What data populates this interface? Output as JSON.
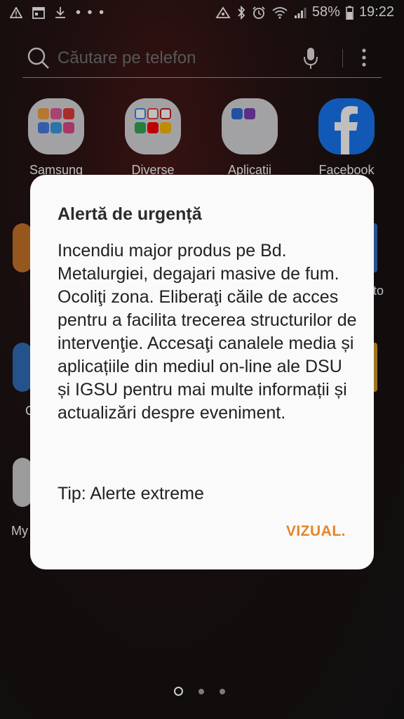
{
  "status_bar": {
    "overflow": "• • •",
    "battery_percent": "58%",
    "time": "19:22",
    "left_icons": [
      "warning-icon",
      "calendar-icon",
      "download-icon"
    ],
    "right_icons": [
      "hotspot-icon",
      "bluetooth-icon",
      "alarm-icon",
      "wifi-icon",
      "signal-icon",
      "battery-icon"
    ]
  },
  "search": {
    "placeholder": "Căutare pe telefon"
  },
  "apps": [
    {
      "label": "Samsung"
    },
    {
      "label": "Diverse"
    },
    {
      "label": "Aplicații"
    },
    {
      "label": "Facebook"
    }
  ],
  "partial_labels": {
    "right_row2": "to",
    "left_row3": "C",
    "left_row4": "My"
  },
  "dialog": {
    "title": "Alertă de urgență",
    "body": "Incendiu major produs pe Bd. Metalurgiei, degajari masive de fum. Ocoliţi zona. Eliberaţi căile de acces pentru a facilita trecerea structurilor de intervenţie. Accesaţi canalele media și aplicațiile din mediul on-line ale DSU și IGSU pentru mai multe informații și actualizări despre eveniment.",
    "type": "Tip: Alerte extreme",
    "button": "VIZUAL."
  },
  "colors": {
    "accent": "#e4852a",
    "facebook": "#1877f2"
  },
  "pager": {
    "pages": 3,
    "current": 1
  }
}
